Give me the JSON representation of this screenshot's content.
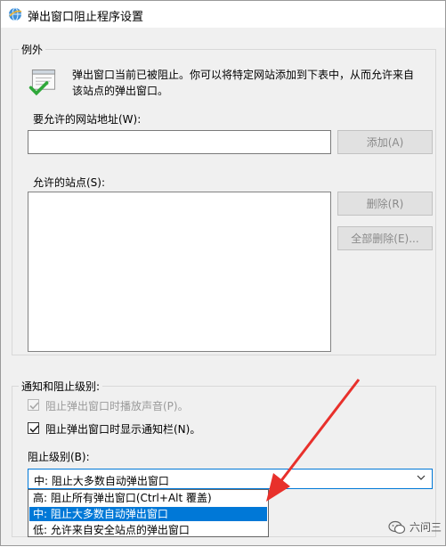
{
  "window": {
    "title": "弹出窗口阻止程序设置",
    "app_icon": "ie-globe-icon"
  },
  "exceptions": {
    "legend": "例外",
    "info_icon": "popup-shield-check-icon",
    "info_line1": "弹出窗口当前已被阻止。你可以将特定网站添加到下表中，从而允许来自",
    "info_line2": "该站点的弹出窗口。",
    "address_label": "要允许的网站地址(W):",
    "address_value": "",
    "add_button": "添加(A)",
    "allowed_label": "允许的站点(S):",
    "allowed_sites": [],
    "remove_button": "删除(R)",
    "remove_all_button": "全部删除(E)..."
  },
  "notify": {
    "legend": "通知和阻止级别:",
    "sound_label": "阻止弹出窗口时播放声音(P)。",
    "sound_checked": true,
    "sound_enabled": false,
    "bar_label": "阻止弹出窗口时显示通知栏(N)。",
    "bar_checked": true,
    "level_label": "阻止级别(B):",
    "level_selected": "中: 阻止大多数自动弹出窗口",
    "level_options": [
      "高: 阻止所有弹出窗口(Ctrl+Alt 覆盖)",
      "中: 阻止大多数自动弹出窗口",
      "低: 允许来自安全站点的弹出窗口"
    ],
    "highlighted_option_index": 1
  },
  "annotation": {
    "arrow_color": "#e8302b"
  },
  "watermark": {
    "text": "六问三",
    "icon": "wechat-icon"
  },
  "colors": {
    "selection": "#0078d7",
    "window_bg": "#f0f0f0"
  }
}
